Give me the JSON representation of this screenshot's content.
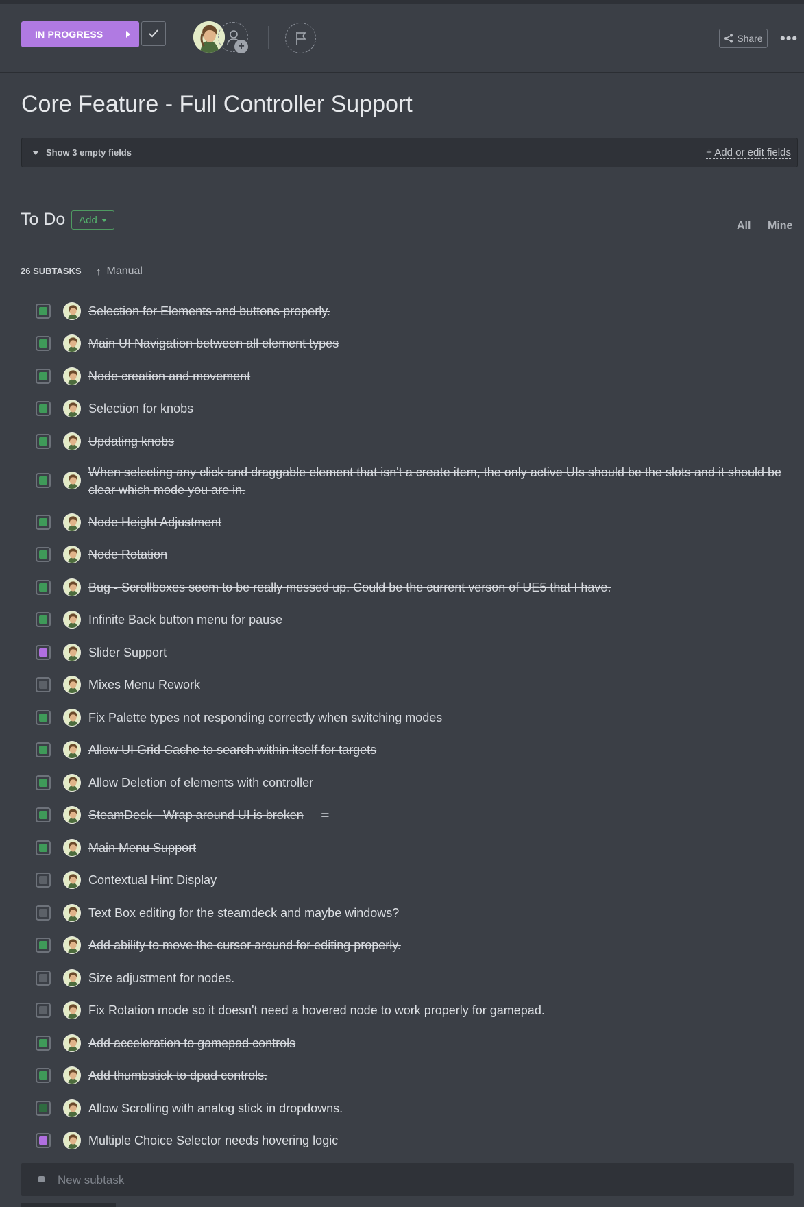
{
  "header": {
    "status_label": "IN PROGRESS",
    "share_label": "Share",
    "more_label": "•••"
  },
  "task": {
    "title": "Core Feature - Full Controller Support",
    "empty_fields_label": "Show 3 empty fields",
    "edit_fields_label": "+ Add or edit fields"
  },
  "todo": {
    "title": "To Do",
    "add_label": "Add",
    "filter_all": "All",
    "filter_mine": "Mine",
    "count_label": "26 SUBTASKS",
    "sort_label": "Manual"
  },
  "subtasks": [
    {
      "text": "Selection for Elements and buttons properly.",
      "status": "done"
    },
    {
      "text": "Main UI Navigation between all element types",
      "status": "done"
    },
    {
      "text": "Node creation and movement",
      "status": "done"
    },
    {
      "text": "Selection for knobs",
      "status": "done"
    },
    {
      "text": "Updating knobs",
      "status": "done"
    },
    {
      "text": "When selecting any click and draggable element that isn't a create item, the only active UIs should be the slots and it should be clear which mode you are in.",
      "status": "done"
    },
    {
      "text": "Node Height Adjustment",
      "status": "done"
    },
    {
      "text": "Node Rotation",
      "status": "done"
    },
    {
      "text": "Bug - Scrollboxes seem to be really messed up. Could be the current verson of UE5 that I have.",
      "status": "done"
    },
    {
      "text": "Infinite Back button menu for pause",
      "status": "done"
    },
    {
      "text": "Slider Support",
      "status": "in-progress"
    },
    {
      "text": "Mixes Menu Rework",
      "status": "todo"
    },
    {
      "text": "Fix Palette types not responding correctly when switching modes",
      "status": "done"
    },
    {
      "text": "Allow UI Grid Cache to search within itself for targets",
      "status": "done"
    },
    {
      "text": "Allow Deletion of elements with controller",
      "status": "done"
    },
    {
      "text": "SteamDeck - Wrap around UI is broken",
      "status": "done",
      "has_description": true
    },
    {
      "text": "Main Menu Support",
      "status": "done"
    },
    {
      "text": "Contextual Hint Display",
      "status": "todo"
    },
    {
      "text": "Text Box editing for the steamdeck and maybe windows?",
      "status": "todo"
    },
    {
      "text": "Add ability to move the cursor around for editing properly.",
      "status": "done"
    },
    {
      "text": "Size adjustment for nodes.",
      "status": "todo"
    },
    {
      "text": "Fix Rotation mode so it doesn't need a hovered node to work properly for gamepad.",
      "status": "todo"
    },
    {
      "text": "Add acceleration to gamepad controls",
      "status": "done"
    },
    {
      "text": "Add thumbstick to dpad controls.",
      "status": "done"
    },
    {
      "text": "Allow Scrolling with analog stick in dropdowns.",
      "status": "review"
    },
    {
      "text": "Multiple Choice Selector needs hovering logic",
      "status": "in-progress"
    }
  ],
  "new_subtask": {
    "placeholder": "New subtask"
  },
  "colors": {
    "in_progress": "#b07ae2",
    "done": "#3f9a59",
    "review": "#2f6b40",
    "todo": "#5c6168"
  }
}
